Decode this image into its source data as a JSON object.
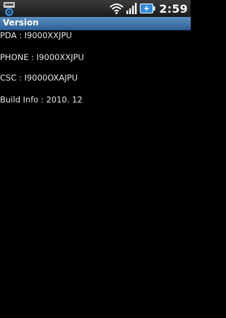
{
  "status_bar": {
    "clock": "2:59",
    "notification_icon": "usb-settings-icon",
    "wifi_icon": "wifi-icon",
    "signal_icon": "signal-bars-icon",
    "battery_icon": "battery-charging-icon",
    "battery_color": "#2f8be0"
  },
  "title_bar": {
    "title": "Version",
    "color": "#3d72aa"
  },
  "version_info": [
    {
      "text": "PDA : I9000XXJPU"
    },
    {
      "text": "PHONE : I9000XXJPU"
    },
    {
      "text": "CSC : I9000OXAJPU"
    },
    {
      "text": "Build Info : 2010. 12"
    }
  ]
}
